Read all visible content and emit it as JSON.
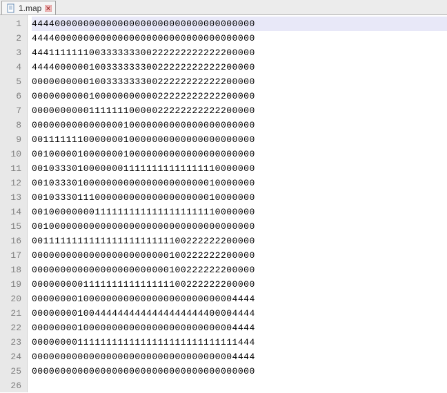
{
  "tab": {
    "filename": "1.map"
  },
  "editor": {
    "current_line": 1,
    "lines": [
      "444400000000000000000000000000000000000",
      "444400000000000000000000000000000000000",
      "444111111100333333300222222222222200000",
      "444400000010033333330022222222222200000",
      "000000000010033333330022222222222200000",
      "000000000010000000000022222222222200000",
      "000000000011111110000022222222222200000",
      "000000000000000010000000000000000000000",
      "001111111000000010000000000000000000000",
      "001000001000000010000000000000000000000",
      "001033301000000011111111111111110000000",
      "001033301000000000000000000000010000000",
      "001033301110000000000000000000010000000",
      "001000000001111111111111111111110000000",
      "001000000000000000000000000000000000000",
      "001111111111111111111111100222222200000",
      "000000000000000000000000100222222200000",
      "000000000000000000000000100222222200000",
      "000000000111111111111111100222222200000",
      "000000001000000000000000000000000004444",
      "000000001004444444444444444444400004444",
      "000000001000000000000000000000000004444",
      "000000001111111111111111111111111111444",
      "000000000000000000000000000000000004444",
      "000000000000000000000000000000000000000",
      ""
    ]
  }
}
